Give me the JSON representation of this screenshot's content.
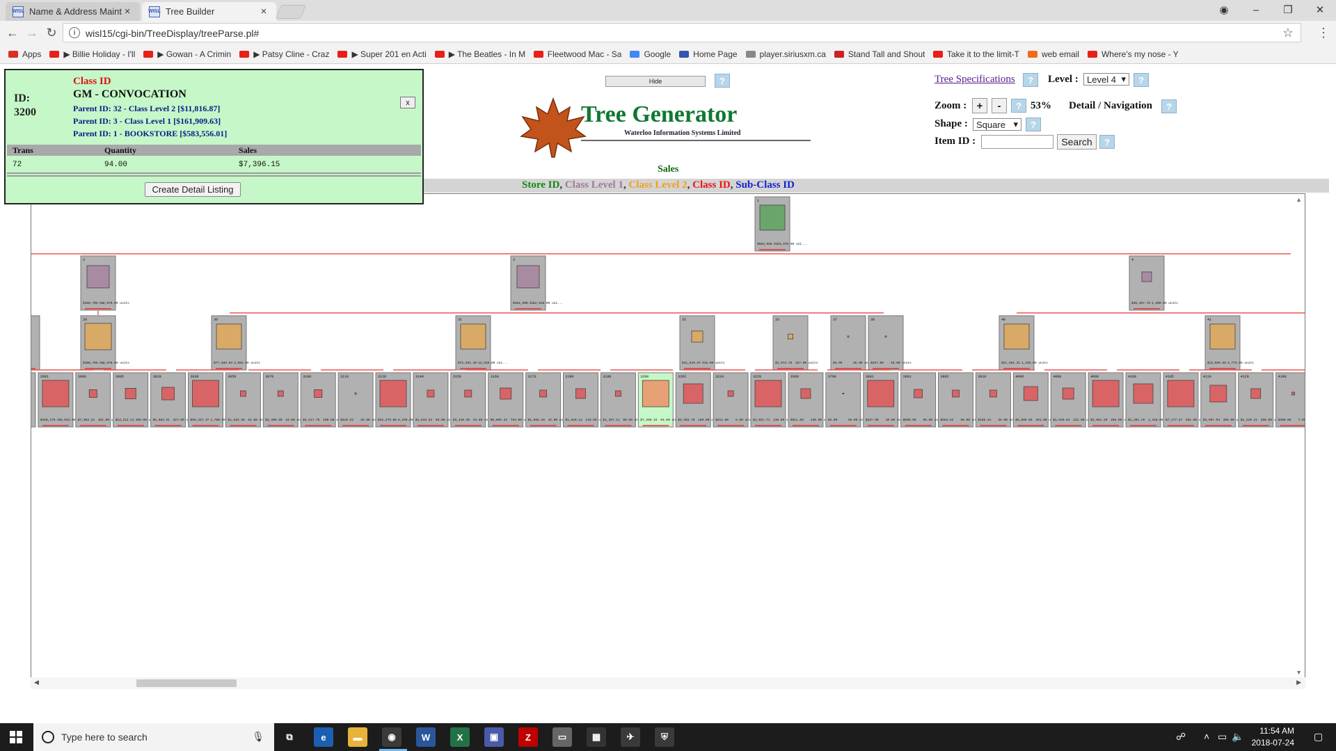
{
  "browser": {
    "tabs": [
      {
        "label": "Name & Address Mainte",
        "favicon": "WISL"
      },
      {
        "label": "Tree Builder",
        "favicon": "WISL"
      }
    ],
    "url": "wisl15/cgi-bin/TreeDisplay/treeParse.pl#",
    "bookmarks": [
      {
        "label": "Apps",
        "color": "#d93025"
      },
      {
        "label": "▶ Billie Holiday - I'll",
        "color": "#e62117"
      },
      {
        "label": "▶ Gowan - A Crimin",
        "color": "#e62117"
      },
      {
        "label": "▶ Patsy Cline - Craz",
        "color": "#e62117"
      },
      {
        "label": "▶ Super 201 en Acti",
        "color": "#e62117"
      },
      {
        "label": "▶ The Beatles - In M",
        "color": "#e62117"
      },
      {
        "label": "Fleetwood Mac - Sa",
        "color": "#e62117"
      },
      {
        "label": "Google",
        "color": "#4285f4"
      },
      {
        "label": "Home Page",
        "color": "#3355aa"
      },
      {
        "label": "player.siriusxm.ca",
        "color": "#888888"
      },
      {
        "label": "Stand Tall and Shout",
        "color": "#cc2222"
      },
      {
        "label": "Take it to the limit-T",
        "color": "#e62117"
      },
      {
        "label": "web email",
        "color": "#f26b1d"
      },
      {
        "label": "Where's my nose - Y",
        "color": "#e62117"
      }
    ]
  },
  "info_panel": {
    "header": "Class ID",
    "id_label": "ID:",
    "id_value": "3200",
    "class_name": "GM - CONVOCATION",
    "parents": [
      "Parent ID: 32 - Class Level 2 [$11,816.87]",
      "Parent ID: 3 - Class Level 1 [$161,909.63]",
      "Parent ID: 1 - BOOKSTORE [$583,556.01]"
    ],
    "close_label": "x",
    "columns": [
      "Trans",
      "Quantity",
      "Sales"
    ],
    "row": [
      "72",
      "94.00",
      "$7,396.15"
    ],
    "detail_button": "Create Detail Listing"
  },
  "controls": {
    "hide_label": "Hide",
    "help_label": "?",
    "tree_spec_link": "Tree Specifications",
    "level_label": "Level :",
    "level_value": "Level 4",
    "zoom_label": "Zoom :",
    "zoom_plus": "+",
    "zoom_minus": "-",
    "zoom_value": "53%",
    "detail_nav_label": "Detail / Navigation",
    "shape_label": "Shape :",
    "shape_value": "Square",
    "item_label": "Item ID :",
    "search_label": "Search"
  },
  "logo": {
    "title": "Tree Generator",
    "subtitle": "Waterloo Information Systems Limited"
  },
  "measure_label": "Sales",
  "legend": [
    {
      "label": "Store ID",
      "color": "#118811"
    },
    {
      "label": "Class Level 1",
      "color": "#a07898"
    },
    {
      "label": "Class Level 2",
      "color": "#f0a020"
    },
    {
      "label": "Class ID",
      "color": "#ee1111"
    },
    {
      "label": "Sub-Class ID",
      "color": "#1122cc"
    }
  ],
  "tree": {
    "colors": {
      "level0": "#6aa66c",
      "level1": "#a98aa3",
      "level2": "#d9aa66",
      "level3": "#d96466",
      "selected": "#e8a075",
      "node_bg": "#b1b1b1",
      "link": "#e63333"
    },
    "root": {
      "id": "1",
      "value": "$583,556.01",
      "units": "33,970.00 uni..."
    },
    "level1": [
      {
        "id": "2",
        "value": "$160,705.55",
        "units": "2,070.00 units",
        "size": 0.8
      },
      {
        "id": "3",
        "value": "$161,909.63",
        "units": "12,818.00 uni...",
        "size": 0.8
      },
      {
        "id": "4",
        "value": "$35,387.78",
        "units": "1,380.00 units",
        "size": 0.35
      }
    ],
    "level2": [
      {
        "id": "",
        "value": "",
        "units": "",
        "size": 0.0
      },
      {
        "id": "20",
        "value": "$160,705.55",
        "units": "2,070.00 units",
        "size": 0.95
      },
      {
        "id": "30",
        "value": "$77,480.53",
        "units": "3,582.00 units",
        "size": 0.9
      },
      {
        "id": "31",
        "value": "$72,391.40",
        "units": "12,910.00 uni...",
        "size": 0.9
      },
      {
        "id": "32",
        "value": "$11,816.87",
        "units": "318.00 units",
        "size": 0.4
      },
      {
        "id": "33",
        "value": "$1,672.75",
        "units": "327.00 units",
        "size": 0.18
      },
      {
        "id": "37",
        "value": "$3.00",
        "units": "36.00 units",
        "size": 0.05
      },
      {
        "id": "38",
        "value": "$327.00",
        "units": "10.00 units",
        "size": 0.05
      },
      {
        "id": "40",
        "value": "$21,302.31",
        "units": "1,193.00 units",
        "size": 0.9
      },
      {
        "id": "41",
        "value": "$13,085.50",
        "units": "2,773.00 units",
        "size": 0.9
      }
    ],
    "level3": [
      {
        "id": "",
        "value": "",
        "units": "",
        "size": 0.9
      },
      {
        "id": "2001",
        "value": "$160,175.55",
        "units": "2,032.00 units",
        "size": 0.95
      },
      {
        "id": "3000",
        "value": "$7,084.22",
        "units": "101.00 units",
        "size": 0.28
      },
      {
        "id": "3005",
        "value": "$13,212.12",
        "units": "109.00 units",
        "size": 0.38
      },
      {
        "id": "3020",
        "value": "$5,682.51",
        "units": "327.00 units",
        "size": 0.45
      },
      {
        "id": "3030",
        "value": "$59,257.37",
        "units": "1,780.00 units",
        "size": 0.95
      },
      {
        "id": "3050",
        "value": "$1,815.38",
        "units": "82.00 units",
        "size": 0.2
      },
      {
        "id": "3070",
        "value": "$2,300.80",
        "units": "43.00 units",
        "size": 0.2
      },
      {
        "id": "3100",
        "value": "$3,517.75",
        "units": "100.00 units",
        "size": 0.28
      },
      {
        "id": "3110",
        "value": "$310.22",
        "units": "25.00 units",
        "size": 0.03
      },
      {
        "id": "3120",
        "value": "$42,379.08",
        "units": "8,259.00 units",
        "size": 0.95
      },
      {
        "id": "3140",
        "value": "$1,843.52",
        "units": "59.00 units",
        "size": 0.25
      },
      {
        "id": "3150",
        "value": "$3,318.20",
        "units": "23.00 units",
        "size": 0.25
      },
      {
        "id": "3160",
        "value": "$5,605.34",
        "units": "753.00 units",
        "size": 0.4
      },
      {
        "id": "3170",
        "value": "$1,086.10",
        "units": "42.00 units",
        "size": 0.25
      },
      {
        "id": "3180",
        "value": "$1,528.12",
        "units": "143.00 units",
        "size": 0.35
      },
      {
        "id": "3190",
        "value": "$1,287.11",
        "units": "80.00 units",
        "size": 0.2
      },
      {
        "id": "3200",
        "value": "$7,396.15",
        "units": "94.00 units",
        "size": 0.95,
        "selected": true
      },
      {
        "id": "3202",
        "value": "$3,302.70",
        "units": "180.00 units",
        "size": 0.7
      },
      {
        "id": "3210",
        "value": "$412.00",
        "units": "5.00 units",
        "size": 0.2
      },
      {
        "id": "3220",
        "value": "$1,021.71",
        "units": "136.00 units",
        "size": 0.95
      },
      {
        "id": "3300",
        "value": "$511.80",
        "units": "138.00 units",
        "size": 0.35
      },
      {
        "id": "3700",
        "value": "$3.00",
        "units": "36.00 units",
        "size": 0.0
      },
      {
        "id": "3801",
        "value": "$327.00",
        "units": "10.00 units",
        "size": 0.95
      },
      {
        "id": "3901",
        "value": "$909.50",
        "units": "95.00 units",
        "size": 0.3
      },
      {
        "id": "3902",
        "value": "$583.52",
        "units": "95.00 units",
        "size": 0.25
      },
      {
        "id": "3910",
        "value": "$180.31",
        "units": "35.00 units",
        "size": 0.25
      },
      {
        "id": "4000",
        "value": "$5,080.06",
        "units": "391.00 units",
        "size": 0.5
      },
      {
        "id": "4080",
        "value": "$1,010.04",
        "units": "222.00 units",
        "size": 0.4
      },
      {
        "id": "4090",
        "value": "$3,881.20",
        "units": "256.00 units",
        "size": 0.95
      },
      {
        "id": "4100",
        "value": "$1,201.15",
        "units": "1,310.00 units",
        "size": 0.7
      },
      {
        "id": "4105",
        "value": "$7,177.27",
        "units": "101.00 units",
        "size": 0.95
      },
      {
        "id": "4110",
        "value": "$3,987.04",
        "units": "306.00 units",
        "size": 0.6
      },
      {
        "id": "4120",
        "value": "$1,120.22",
        "units": "280.00 units",
        "size": 0.35
      },
      {
        "id": "4180",
        "value": "$300.00",
        "units": "7.00 units",
        "size": 0.1
      }
    ]
  },
  "taskbar": {
    "search_placeholder": "Type here to search",
    "apps": [
      {
        "icon": "task-view-icon",
        "glyph": "⧉",
        "color": "#1c1c1c"
      },
      {
        "icon": "edge-icon",
        "glyph": "e",
        "color": "#1c5fb0"
      },
      {
        "icon": "file-explorer-icon",
        "glyph": "▬",
        "color": "#e8b33a"
      },
      {
        "icon": "chrome-icon",
        "glyph": "◉",
        "color": "#3a3a3a"
      },
      {
        "icon": "word-icon",
        "glyph": "W",
        "color": "#2b579a"
      },
      {
        "icon": "excel-icon",
        "glyph": "X",
        "color": "#217346"
      },
      {
        "icon": "wisl-app-icon",
        "glyph": "▣",
        "color": "#4b5aa8"
      },
      {
        "icon": "filezilla-icon",
        "glyph": "Z",
        "color": "#bf0000"
      },
      {
        "icon": "photos-icon",
        "glyph": "▭",
        "color": "#666666"
      },
      {
        "icon": "calculator-icon",
        "glyph": "▦",
        "color": "#333333"
      },
      {
        "icon": "bird-app-icon",
        "glyph": "✈",
        "color": "#3a3a3a"
      },
      {
        "icon": "shield-app-icon",
        "glyph": "⛨",
        "color": "#3a3a3a"
      }
    ],
    "time": "11:54 AM",
    "date": "2018-07-24"
  }
}
